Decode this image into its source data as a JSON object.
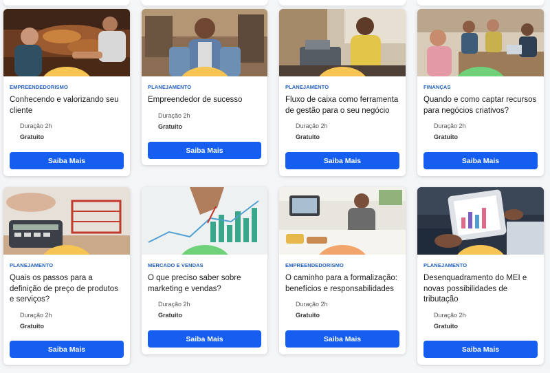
{
  "cards": [
    {
      "category": "EMPREENDEDORISMO",
      "title": "Conhecendo e valorizando seu cliente",
      "duration": "Duração 2h",
      "price": "Gratuito",
      "cta": "Saiba Mais",
      "chip_color": "#f6c453"
    },
    {
      "category": "PLANEJAMENTO",
      "title": "Empreendedor de sucesso",
      "duration": "Duração 2h",
      "price": "Gratuito",
      "cta": "Saiba Mais",
      "chip_color": "#f6c453"
    },
    {
      "category": "PLANEJAMENTO",
      "title": "Fluxo de caixa como ferramenta de gestão para o seu negócio",
      "duration": "Duração 2h",
      "price": "Gratuito",
      "cta": "Saiba Mais",
      "chip_color": "#f6c453"
    },
    {
      "category": "FINANÇAS",
      "title": "Quando e como captar recursos para negócios criativos?",
      "duration": "Duração 2h",
      "price": "Gratuito",
      "cta": "Saiba Mais",
      "chip_color": "#6fd17a"
    },
    {
      "category": "PLANEJAMENTO",
      "title": "Quais os passos para a definição de preço de produtos e serviços?",
      "duration": "Duração 2h",
      "price": "Gratuito",
      "cta": "Saiba Mais",
      "chip_color": "#f6c453"
    },
    {
      "category": "MERCADO E VENDAS",
      "title": "O que preciso saber sobre marketing e vendas?",
      "duration": "Duração 2h",
      "price": "Gratuito",
      "cta": "Saiba Mais",
      "chip_color": "#6fd17a"
    },
    {
      "category": "EMPREENDEDORISMO",
      "title": "O caminho para a formalização: benefícios e responsabilidades",
      "duration": "Duração 2h",
      "price": "Gratuito",
      "cta": "Saiba Mais",
      "chip_color": "#f2a56b"
    },
    {
      "category": "PLANEJAMENTO",
      "title": "Desenquadramento do MEI e novas possibilidades de tributação",
      "duration": "Duração 2h",
      "price": "Gratuito",
      "cta": "Saiba Mais",
      "chip_color": "#f6c453"
    }
  ],
  "images": [
    "market-vendor-photo",
    "smiling-entrepreneur-photo",
    "cashier-register-photo",
    "coworking-team-photo",
    "calculator-cart-photo",
    "marketing-charts-photo",
    "bakery-owner-photo",
    "tablet-charts-photo"
  ],
  "icons": {
    "chip": "whatsapp-icon"
  },
  "colors": {
    "accent": "#155eef",
    "category_text": "#1f5fbf"
  }
}
